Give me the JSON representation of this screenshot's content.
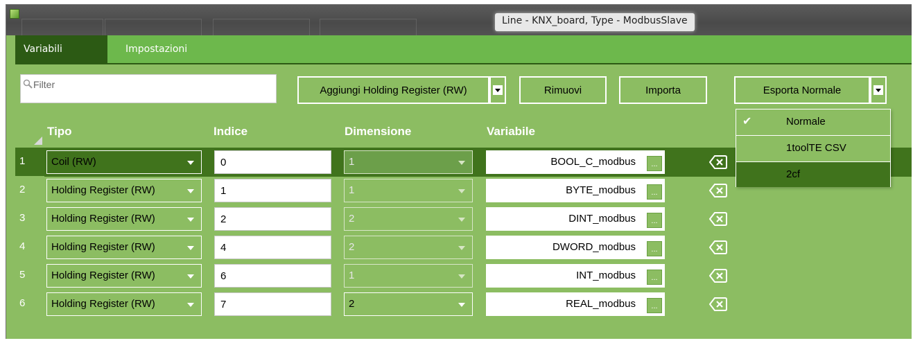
{
  "window": {
    "title": "Line - KNX_board, Type - ModbusSlave"
  },
  "tabs": [
    {
      "label": "Variabili",
      "active": true
    },
    {
      "label": "Impostazioni",
      "active": false
    }
  ],
  "toolbar": {
    "filter_placeholder": "Filter",
    "add_label": "Aggiungi Holding Register (RW)",
    "remove_label": "Rimuovi",
    "import_label": "Importa",
    "export_label": "Esporta Normale"
  },
  "columns": {
    "tipo": "Tipo",
    "indice": "Indice",
    "dimensione": "Dimensione",
    "variabile": "Variabile"
  },
  "rows": [
    {
      "num": "1",
      "tipo": "Coil (RW)",
      "indice": "0",
      "dimensione": "1",
      "variabile": "BOOL_C_modbus",
      "dim_enabled": false,
      "selected": true
    },
    {
      "num": "2",
      "tipo": "Holding Register (RW)",
      "indice": "1",
      "dimensione": "1",
      "variabile": "BYTE_modbus",
      "dim_enabled": false,
      "selected": false
    },
    {
      "num": "3",
      "tipo": "Holding Register (RW)",
      "indice": "2",
      "dimensione": "2",
      "variabile": "DINT_modbus",
      "dim_enabled": false,
      "selected": false
    },
    {
      "num": "4",
      "tipo": "Holding Register (RW)",
      "indice": "4",
      "dimensione": "2",
      "variabile": "DWORD_modbus",
      "dim_enabled": false,
      "selected": false
    },
    {
      "num": "5",
      "tipo": "Holding Register (RW)",
      "indice": "6",
      "dimensione": "1",
      "variabile": "INT_modbus",
      "dim_enabled": false,
      "selected": false
    },
    {
      "num": "6",
      "tipo": "Holding Register (RW)",
      "indice": "7",
      "dimensione": "2",
      "variabile": "REAL_modbus",
      "dim_enabled": true,
      "selected": false
    }
  ],
  "browse_label": "...",
  "export_menu": {
    "items": [
      {
        "label": "Normale",
        "checked": true,
        "highlighted": false
      },
      {
        "label": "1toolTE CSV",
        "checked": false,
        "highlighted": false
      },
      {
        "label": "2cf",
        "checked": false,
        "highlighted": true
      }
    ]
  },
  "colors": {
    "accent_green": "#8cbd62",
    "tab_green": "#6db84c",
    "selected_green": "#40731c",
    "dark_tab": "#2c5a14"
  }
}
